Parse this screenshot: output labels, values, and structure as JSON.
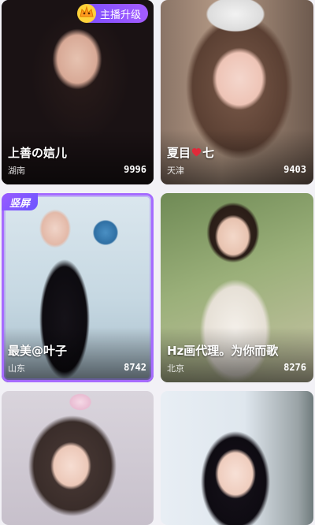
{
  "promo": {
    "label": "主播升级",
    "icon": "crown-icon"
  },
  "vertical_badge": "竖屏",
  "cards": [
    {
      "name": "上善の娮儿",
      "city": "湖南",
      "count": "9996"
    },
    {
      "name_before": "夏目",
      "name_after": "七",
      "name_icon": "heart-icon",
      "city": "天津",
      "count": "9403"
    },
    {
      "name": "最美@叶子",
      "city": "山东",
      "count": "8742"
    },
    {
      "name": "Hz画代理。为你而歌",
      "city": "北京",
      "count": "8276"
    },
    {
      "name": "",
      "city": "",
      "count": ""
    },
    {
      "name": "",
      "city": "",
      "count": ""
    }
  ],
  "colors": {
    "accent": "#a66bff",
    "heart": "#e02a3a",
    "background": "#f2f1f6"
  }
}
